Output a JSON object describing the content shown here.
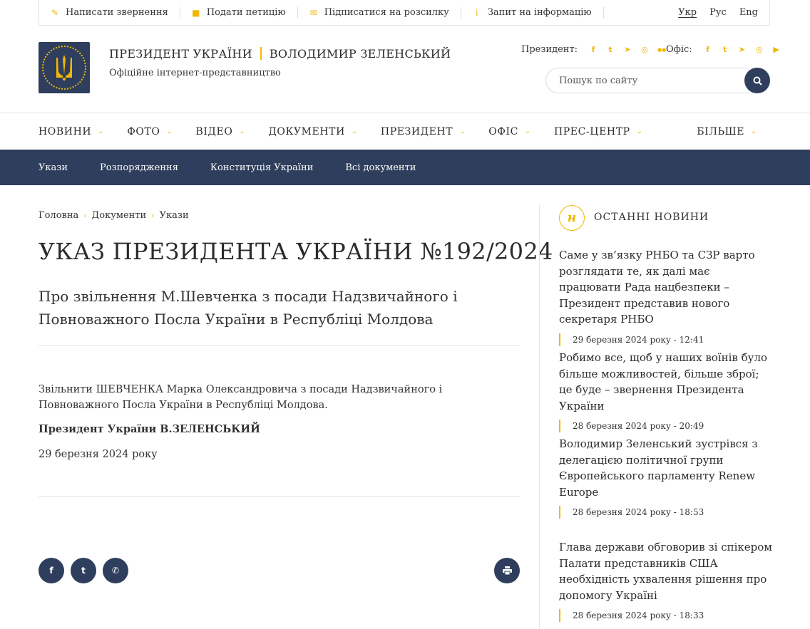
{
  "topbar": {
    "links": [
      {
        "icon": "pencil-icon",
        "glyph": "✎",
        "label": "Написати звернення"
      },
      {
        "icon": "document-icon",
        "glyph": "■",
        "label": "Подати петицію"
      },
      {
        "icon": "envelope-icon",
        "glyph": "✉",
        "label": "Підписатися на розсилку"
      },
      {
        "icon": "info-icon",
        "glyph": "i",
        "label": "Запит на інформацію"
      }
    ],
    "langs": [
      "Укр",
      "Рус",
      "Eng"
    ],
    "active_lang": "Укр"
  },
  "header": {
    "title_left": "ПРЕЗИДЕНТ УКРАЇНИ",
    "title_right": "ВОЛОДИМИР ЗЕЛЕНСЬКИЙ",
    "subtitle": "Офіційне інтернет-представництво",
    "president_label": "Президент:",
    "office_label": "Офіс:",
    "president_socials": [
      {
        "icon": "facebook-icon",
        "glyph": "f"
      },
      {
        "icon": "twitter-icon",
        "glyph": "t"
      },
      {
        "icon": "telegram-icon",
        "glyph": "➤"
      },
      {
        "icon": "instagram-icon",
        "glyph": "◎"
      },
      {
        "icon": "flickr-icon",
        "glyph": "●●"
      }
    ],
    "office_socials": [
      {
        "icon": "facebook-icon",
        "glyph": "f"
      },
      {
        "icon": "twitter-icon",
        "glyph": "t"
      },
      {
        "icon": "telegram-icon",
        "glyph": "➤"
      },
      {
        "icon": "instagram-icon",
        "glyph": "◎"
      },
      {
        "icon": "youtube-icon",
        "glyph": "▶"
      }
    ],
    "search_placeholder": "Пошук по сайту"
  },
  "mainnav": [
    "НОВИНИ",
    "ФОТО",
    "ВІДЕО",
    "ДОКУМЕНТИ",
    "ПРЕЗИДЕНТ",
    "ОФІС",
    "ПРЕС-ЦЕНТР"
  ],
  "mainnav_more": "БІЛЬШЕ",
  "subnav": [
    "Укази",
    "Розпорядження",
    "Конституція України",
    "Всі документи"
  ],
  "breadcrumb": [
    "Головна",
    "Документи",
    "Укази"
  ],
  "decree": {
    "title": "УКАЗ ПРЕЗИДЕНТА УКРАЇНИ №192/2024",
    "subtitle": "Про звільнення М.Шевченка з посади Надзвичайного і Повноважного Посла України в Республіці Молдова",
    "body": "Звільнити ШЕВЧЕНКА Марка Олександровича з посади Надзвичайного і Повноважного Посла України в Республіці Молдова.",
    "signature": "Президент України В.ЗЕЛЕНСЬКИЙ",
    "date": "29 березня 2024 року"
  },
  "share": [
    {
      "icon": "facebook-icon",
      "glyph": "f"
    },
    {
      "icon": "twitter-icon",
      "glyph": "t"
    },
    {
      "icon": "whatsapp-icon",
      "glyph": "✆"
    }
  ],
  "print_icon": "print-icon",
  "news": {
    "badge": "н",
    "title": "ОСТАННІ НОВИНИ",
    "items": [
      {
        "headline": "Саме у зв’язку РНБО та СЗР варто розглядати те, як далі має працювати Рада нацбезпеки – Президент представив нового секретаря РНБО",
        "date": "29 березня 2024 року - 12:41"
      },
      {
        "headline": "Робимо все, щоб у наших воїнів було більше можливостей, більше зброї; це буде – звернення Президента України",
        "date": "28 березня 2024 року - 20:49"
      },
      {
        "headline": "Володимир Зеленський зустрівся з делегацією політичної групи Європейського парламенту Renew Europe",
        "date": "28 березня 2024 року - 18:53"
      },
      {
        "headline": "Глава держави обговорив зі спікером Палати представників США необхідність ухвалення рішення про допомогу Україні",
        "date": "28 березня 2024 року - 18:33"
      }
    ]
  },
  "colors": {
    "accent": "#f2b705",
    "navy": "#2e3e5c"
  }
}
